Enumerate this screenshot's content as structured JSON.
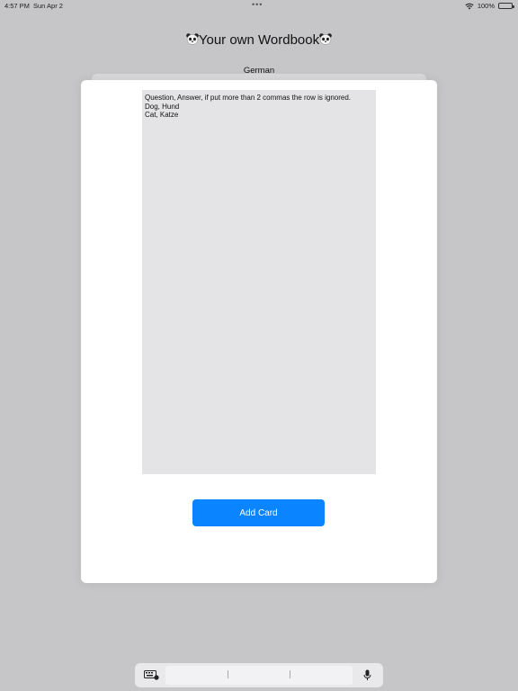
{
  "status_bar": {
    "time": "4:57 PM",
    "date": "Sun Apr 2",
    "multitask": "•••",
    "battery": "100%"
  },
  "header": {
    "title": "Your own Wordbook",
    "icon": "panda-emoji"
  },
  "deck": {
    "language": "German"
  },
  "editor": {
    "text": "Question, Answer, if put more than 2 commas the row is ignored.\nDog, Hund\nCat, Katze"
  },
  "actions": {
    "add_card": "Add Card"
  },
  "colors": {
    "accent": "#0a84ff",
    "editor_bg": "#e4e4e7",
    "backdrop": "#c6c6c8"
  }
}
